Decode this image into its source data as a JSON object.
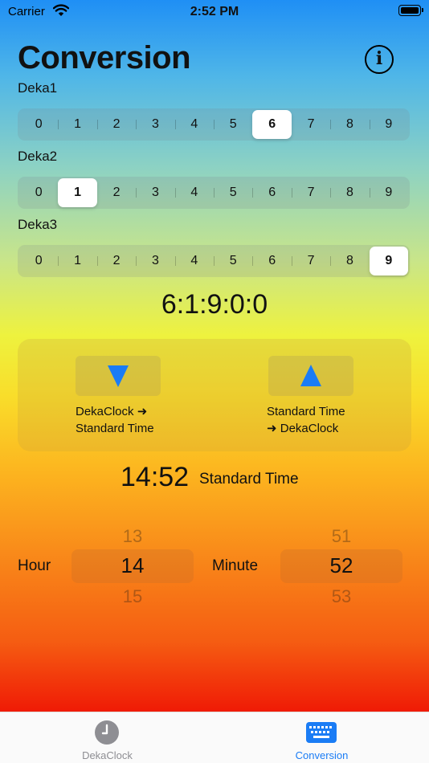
{
  "status": {
    "carrier": "Carrier",
    "time": "2:52 PM"
  },
  "header": {
    "title": "Conversion",
    "info_glyph": "i"
  },
  "deka1": {
    "label": "Deka1",
    "options": [
      "0",
      "1",
      "2",
      "3",
      "4",
      "5",
      "6",
      "7",
      "8",
      "9"
    ],
    "selected": 6
  },
  "deka2": {
    "label": "Deka2",
    "options": [
      "0",
      "1",
      "2",
      "3",
      "4",
      "5",
      "6",
      "7",
      "8",
      "9"
    ],
    "selected": 1
  },
  "deka3": {
    "label": "Deka3",
    "options": [
      "0",
      "1",
      "2",
      "3",
      "4",
      "5",
      "6",
      "7",
      "8",
      "9"
    ],
    "selected": 9
  },
  "deka_result": "6:1:9:0:0",
  "convert": {
    "to_standard": {
      "icon": "triangle-down-icon",
      "line1": "DekaClock ➜",
      "line2": "Standard Time"
    },
    "to_deka": {
      "icon": "triangle-up-icon",
      "line1": "Standard Time",
      "line2": "➜ DekaClock"
    },
    "accent_color": "#1a7cf5"
  },
  "standard": {
    "time": "14:52",
    "label": "Standard Time"
  },
  "pickers": {
    "hour": {
      "label": "Hour",
      "prev": "13",
      "value": "14",
      "next": "15"
    },
    "minute": {
      "label": "Minute",
      "prev": "51",
      "value": "52",
      "next": "53"
    }
  },
  "tabs": [
    {
      "label": "DekaClock",
      "icon": "clock-icon",
      "active": false
    },
    {
      "label": "Conversion",
      "icon": "keyboard-icon",
      "active": true
    }
  ],
  "tab_active_color": "#1a7cf5",
  "tab_inactive_color": "#8e8e93"
}
